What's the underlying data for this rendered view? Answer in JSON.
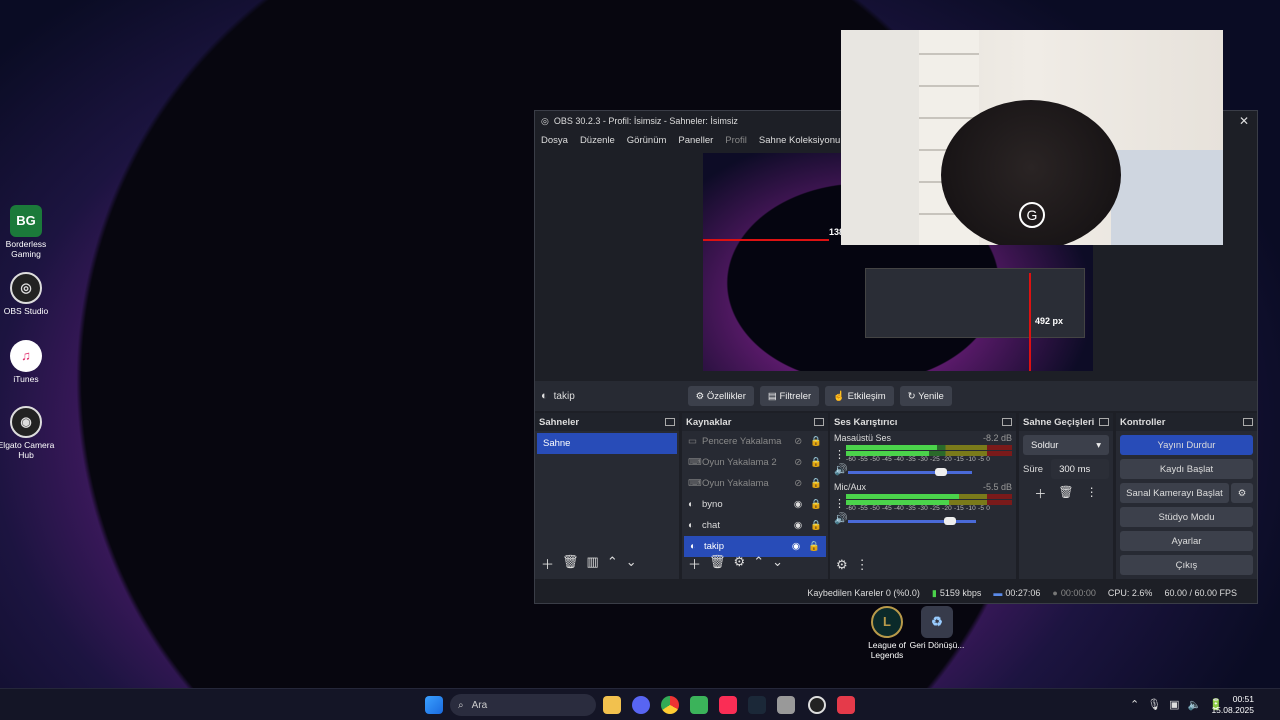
{
  "desktop_icons": [
    {
      "label": "Borderless Gaming",
      "icon": "borderless-gaming-icon"
    },
    {
      "label": "OBS Studio",
      "icon": "obs-icon"
    },
    {
      "label": "iTunes",
      "icon": "itunes-icon"
    },
    {
      "label": "Elgato Camera Hub",
      "icon": "elgato-icon"
    },
    {
      "label": "League of Legends",
      "icon": "lol-icon"
    },
    {
      "label": "Geri Dönüşü...",
      "icon": "recycle-bin-icon"
    }
  ],
  "window": {
    "title": "OBS 30.2.3 - Profil: İsimsiz - Sahneler: İsimsiz"
  },
  "menu": [
    "Dosya",
    "Düzenle",
    "Görünüm",
    "Paneller",
    "Profil",
    "Sahne Koleksiyonu",
    "Ar"
  ],
  "preview": {
    "label_a": "138",
    "label_b": "492 px"
  },
  "source_toolbar": {
    "name": "takip",
    "props": "Özellikler",
    "filters": "Filtreler",
    "interact": "Etkileşim",
    "refresh": "Yenile"
  },
  "scenes": {
    "title": "Sahneler",
    "items": [
      "Sahne"
    ]
  },
  "sources": {
    "title": "Kaynaklar",
    "items": [
      {
        "name": "Pencere Yakalama",
        "visible": false
      },
      {
        "name": "Oyun Yakalama 2",
        "visible": false
      },
      {
        "name": "Oyun Yakalama",
        "visible": false
      },
      {
        "name": "byno",
        "visible": true
      },
      {
        "name": "chat",
        "visible": true
      },
      {
        "name": "takip",
        "visible": true
      }
    ]
  },
  "mixer": {
    "title": "Ses Karıştırıcı",
    "channels": [
      {
        "name": "Masaüstü Ses",
        "db": "-8.2 dB",
        "level": 0.55,
        "volume": 0.7
      },
      {
        "name": "Mic/Aux",
        "db": "-5.5 dB",
        "level": 0.68,
        "volume": 0.75
      }
    ],
    "scale": "-60 -55 -50 -45 -40 -35 -30 -25 -20 -15 -10 -5 0"
  },
  "transitions": {
    "title": "Sahne Geçişleri",
    "type": "Soldur",
    "duration_label": "Süre",
    "duration": "300 ms"
  },
  "controls": {
    "title": "Kontroller",
    "buttons": [
      "Yayını Durdur",
      "Kaydı Başlat",
      "Sanal Kamerayı Başlat",
      "Stüdyo Modu",
      "Ayarlar",
      "Çıkış"
    ]
  },
  "status": {
    "dropped": "Kaybedilen Kareler 0 (%0.0)",
    "bitrate": "5159 kbps",
    "live_time": "00:27:06",
    "rec_time": "00:00:00",
    "cpu": "CPU: 2.6%",
    "fps": "60.00 / 60.00 FPS"
  },
  "taskbar": {
    "search": "Ara",
    "time": "00:51",
    "date": "15.08.2025"
  },
  "colors": {
    "accent": "#284cb8",
    "panel": "#272a33",
    "window": "#1d1f26"
  }
}
